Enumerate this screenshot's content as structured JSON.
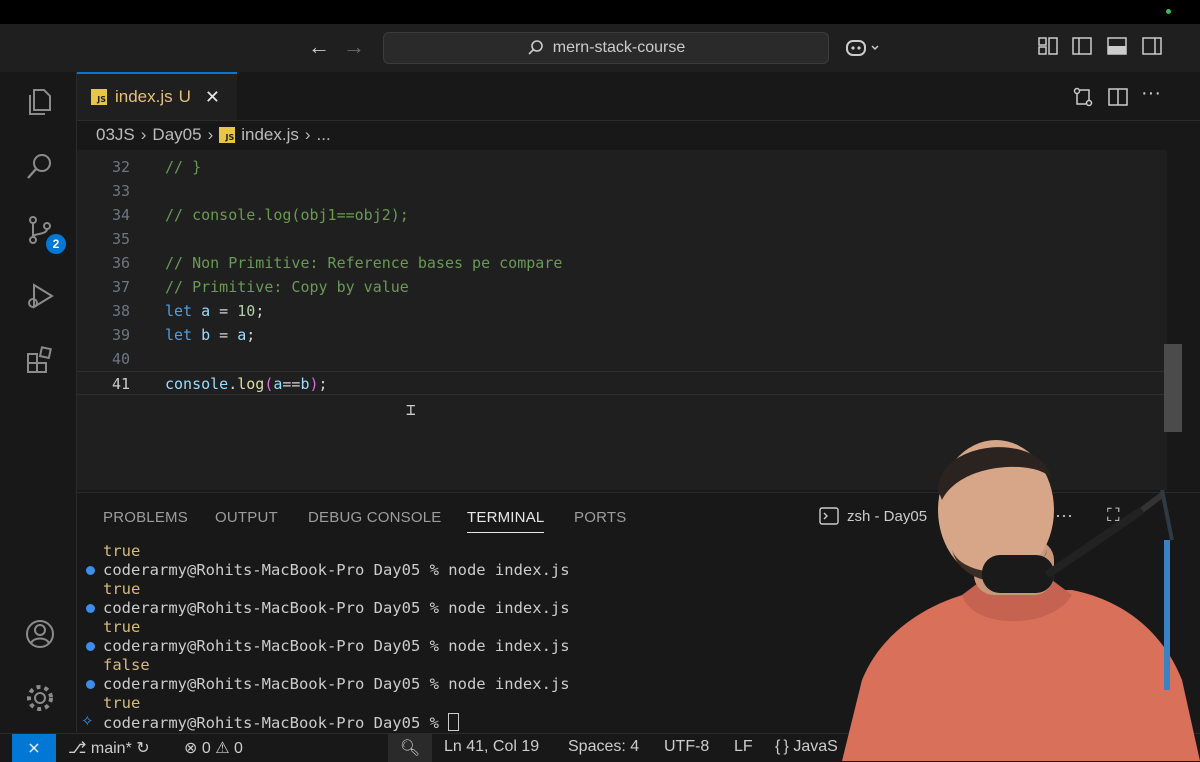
{
  "titlebar": {
    "search_text": "mern-stack-course",
    "back_icon": "arrow-left-icon",
    "forward_icon": "arrow-right-icon",
    "copilot_icon": "copilot-icon"
  },
  "activity_bar": {
    "items": [
      "explorer-icon",
      "search-icon",
      "source-control-icon",
      "run-debug-icon",
      "extensions-icon",
      "account-icon",
      "manage-gear-icon"
    ],
    "source_control_badge": "2"
  },
  "tab": {
    "js_badge": "JS",
    "label": "index.js",
    "status": "U"
  },
  "breadcrumb": [
    "03JS",
    "Day05",
    "index.js",
    "..."
  ],
  "editor": {
    "lines": [
      {
        "num": "32",
        "text": "// }"
      },
      {
        "num": "33",
        "text": ""
      },
      {
        "num": "34",
        "text": "// console.log(obj1==obj2);"
      },
      {
        "num": "35",
        "text": ""
      },
      {
        "num": "36",
        "text": "// Non Primitive: Reference bases pe compare"
      },
      {
        "num": "37",
        "text": "// Primitive: Copy by value"
      },
      {
        "num": "38",
        "kw": "let",
        "var": "a",
        "op": " = ",
        "val": "10",
        "end": ";"
      },
      {
        "num": "39",
        "kw": "let",
        "var": "b",
        "op": " = ",
        "val": "a",
        "end": ";"
      },
      {
        "num": "40",
        "text": ""
      },
      {
        "num": "41",
        "obj": "console",
        "dot": ".",
        "fn": "log",
        "open": "(",
        "a": "a",
        "eq": "==",
        "b": "b",
        "close": ")",
        "end": ";"
      }
    ]
  },
  "panel": {
    "tabs": [
      "PROBLEMS",
      "OUTPUT",
      "DEBUG CONSOLE",
      "TERMINAL",
      "PORTS"
    ],
    "active_tab": "TERMINAL",
    "terminal_label": "zsh - Day05",
    "more": "···",
    "terminal_lines": [
      {
        "type": "out",
        "text": "true"
      },
      {
        "type": "cmd",
        "text": "coderarmy@Rohits-MacBook-Pro Day05 % node index.js"
      },
      {
        "type": "out",
        "text": "true"
      },
      {
        "type": "cmd",
        "text": "coderarmy@Rohits-MacBook-Pro Day05 % node index.js"
      },
      {
        "type": "out",
        "text": "true"
      },
      {
        "type": "cmd",
        "text": "coderarmy@Rohits-MacBook-Pro Day05 % node index.js"
      },
      {
        "type": "out",
        "text": "false"
      },
      {
        "type": "cmd",
        "text": "coderarmy@Rohits-MacBook-Pro Day05 % node index.js"
      },
      {
        "type": "out",
        "text": "true"
      },
      {
        "type": "prompt",
        "text": "coderarmy@Rohits-MacBook-Pro Day05 % "
      }
    ]
  },
  "statusbar": {
    "branch": "main*",
    "errors": "0",
    "warnings": "0",
    "position": "Ln 41, Col 19",
    "spaces": "Spaces: 4",
    "encoding": "UTF-8",
    "eol": "LF",
    "language": "JavaS"
  },
  "colors": {
    "accent": "#0078d4",
    "comment": "#6a9955",
    "keyword": "#569cd6",
    "variable": "#9cdcfe",
    "function": "#dcdcaa",
    "number": "#b5cea8"
  }
}
